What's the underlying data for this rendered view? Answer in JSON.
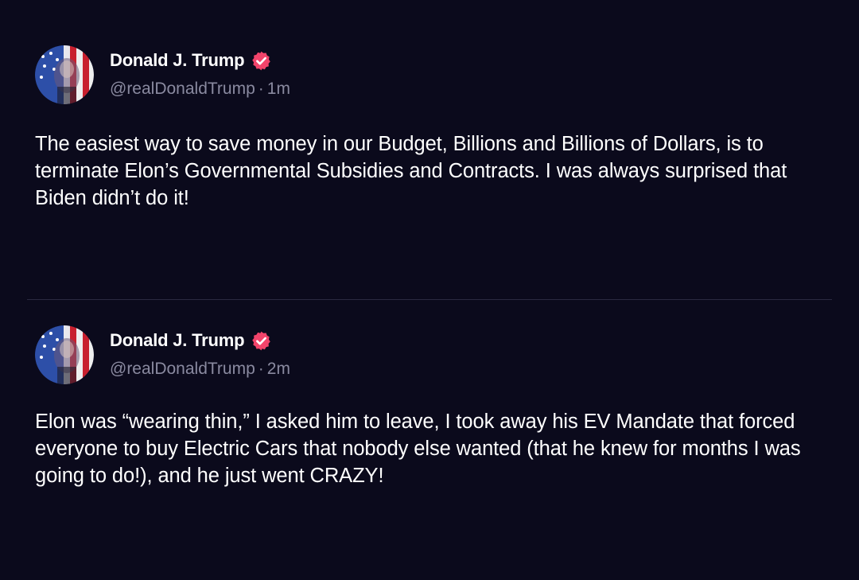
{
  "colors": {
    "background": "#0b0a1c",
    "text": "#ffffff",
    "muted": "#8a8aa0",
    "verified_badge": "#f2446b",
    "divider": "#2a2940"
  },
  "posts": [
    {
      "author": {
        "display_name": "Donald J. Trump",
        "handle": "@realDonaldTrump",
        "verified_icon": "verified-badge-icon"
      },
      "separator": "·",
      "time": "1m",
      "text": "The easiest way to save money in our Budget, Billions and Billions of Dollars, is to terminate Elon’s Governmental Subsidies and Contracts. I was always surprised that Biden didn’t do it!"
    },
    {
      "author": {
        "display_name": "Donald J. Trump",
        "handle": "@realDonaldTrump",
        "verified_icon": "verified-badge-icon"
      },
      "separator": "·",
      "time": "2m",
      "text": "Elon was “wearing thin,” I asked him to leave, I took away his EV Mandate that forced everyone to buy Electric Cars that nobody else wanted (that he knew for months I was going to do!), and he just went CRAZY!"
    }
  ]
}
